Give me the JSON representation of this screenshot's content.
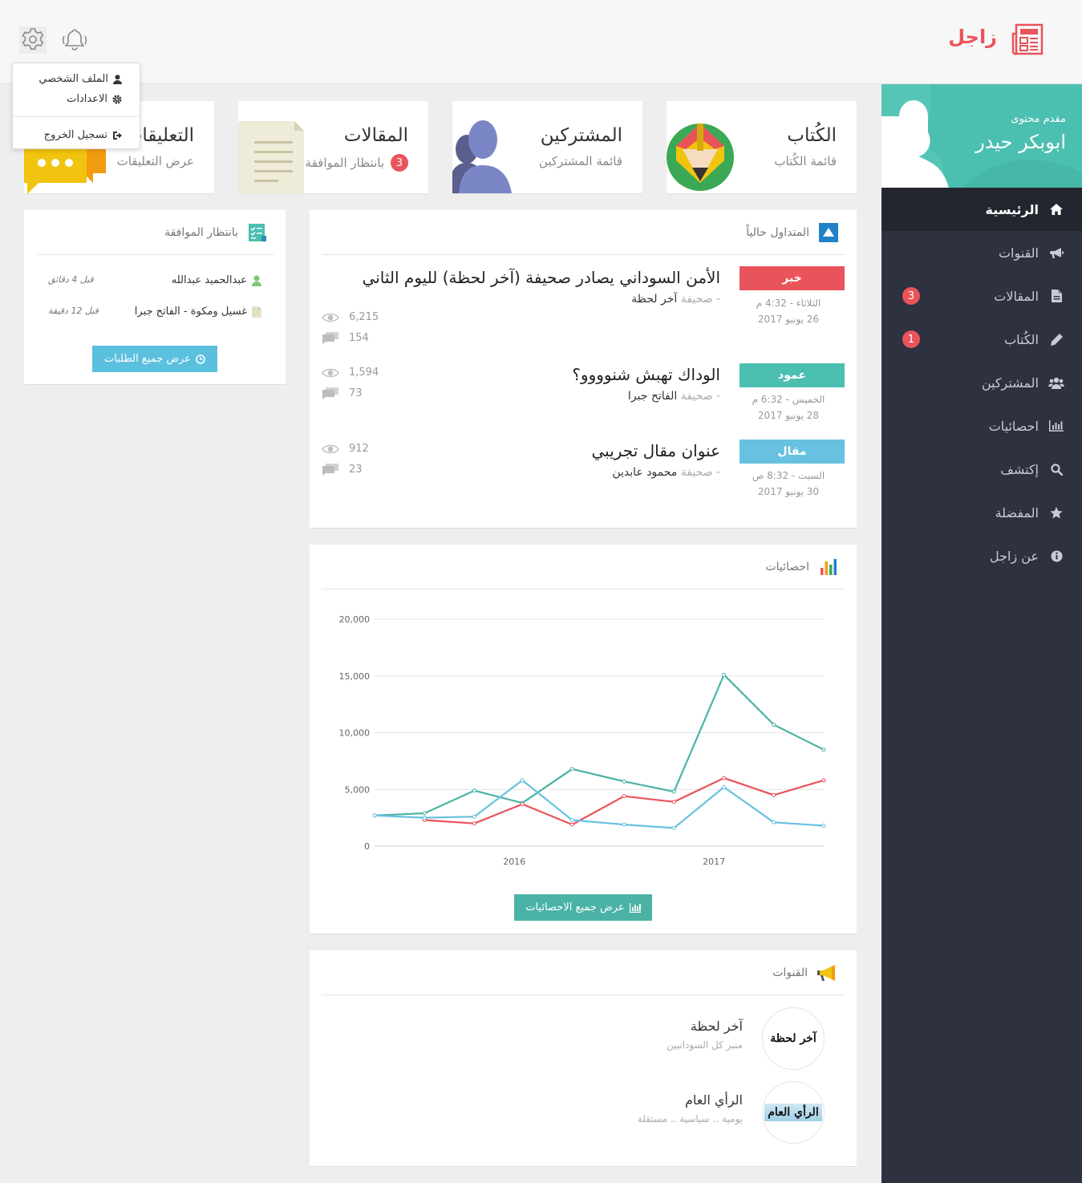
{
  "app": {
    "name": "زاجل"
  },
  "user_menu": {
    "profile": "الملف الشخصي",
    "settings": "الاعدادات",
    "logout": "تسجيل الخروج"
  },
  "profile": {
    "role": "مقدم محتوى",
    "name": "ابوبكر حيدر"
  },
  "sidebar": {
    "items": [
      {
        "label": "الرئيسية",
        "icon": "home-icon",
        "active": true
      },
      {
        "label": "القنوات",
        "icon": "megaphone-icon"
      },
      {
        "label": "المقالات",
        "icon": "file-icon",
        "badge": "3"
      },
      {
        "label": "الكُتاب",
        "icon": "pencil-icon",
        "badge": "1"
      },
      {
        "label": "المشتركين",
        "icon": "users-icon"
      },
      {
        "label": "احصائيات",
        "icon": "bar-chart-icon"
      },
      {
        "label": "إكتشف",
        "icon": "search-icon"
      },
      {
        "label": "المفضلة",
        "icon": "star-icon"
      },
      {
        "label": "عن زاجل",
        "icon": "info-icon"
      }
    ]
  },
  "stats_cards": [
    {
      "title": "الكُتاب",
      "subtitle": "قائمة الكُتاب"
    },
    {
      "title": "المشتركين",
      "subtitle": "قائمة المشتركين"
    },
    {
      "title": "المقالات",
      "subtitle": "بانتظار الموافقة",
      "badge": "3"
    },
    {
      "title": "التعليقات",
      "subtitle": "عرض التعليقات"
    }
  ],
  "trending": {
    "title": "المتداول حالياً",
    "items": [
      {
        "tag": "خبر",
        "tag_color": "#e9545a",
        "date_line1": "الثلاثاء - 4:32 م",
        "date_line2": "26 يونيو 2017",
        "title": "الأمن السوداني يصادر صحيفة (آخر لحظة) لليوم الثاني",
        "source_prefix": "- صحيفة",
        "source": "آخر لحظة",
        "views": "6,215",
        "comments": "154"
      },
      {
        "tag": "عمود",
        "tag_color": "#4bbfb0",
        "date_line1": "الخميس - 6:32 م",
        "date_line2": "28 يونيو 2017",
        "title": "الوداك تهبش شنوووو؟",
        "source_prefix": "- صحيفة",
        "source": "الفاتح جبرا",
        "views": "1,594",
        "comments": "73"
      },
      {
        "tag": "مقال",
        "tag_color": "#68c1e0",
        "date_line1": "السبت - 8:32 ص",
        "date_line2": "30 يونيو 2017",
        "title": "عنوان مقال تجريبي",
        "source_prefix": "- صحيفة",
        "source": "محمود عابدين",
        "views": "912",
        "comments": "23"
      }
    ]
  },
  "pending": {
    "title": "بانتظار الموافقة",
    "items": [
      {
        "name": "عبدالحميد عبدالله",
        "icon": "user-icon",
        "time": "قبل 4 دقائق"
      },
      {
        "name": "غسيل ومكوة - الفاتح جبرا",
        "icon": "document-icon",
        "time": "قبل 12 دقيقة"
      }
    ],
    "button": "عرض جميع الطلبات"
  },
  "stats_panel": {
    "title": "احصائيات",
    "button": "عرض جميع الاحصائيات"
  },
  "chart_data": {
    "type": "line",
    "x": [
      2015.3,
      2015.55,
      2015.8,
      2016.04,
      2016.29,
      2016.55,
      2016.8,
      2017.05,
      2017.3,
      2017.55
    ],
    "series": [
      {
        "color": "#4bb3a6",
        "values": [
          2700,
          2900,
          4900,
          3800,
          6800,
          5700,
          4800,
          15100,
          10700,
          8500
        ]
      },
      {
        "color": "#e9545a",
        "values": [
          null,
          2300,
          2000,
          3700,
          1900,
          4400,
          3900,
          6000,
          4500,
          5800
        ]
      },
      {
        "color": "#68c1e0",
        "values": [
          2700,
          2500,
          2600,
          5800,
          2300,
          1900,
          1600,
          5200,
          2100,
          1800
        ]
      }
    ],
    "x_ticks": [
      2016,
      2017
    ],
    "x_tick_labels": [
      "2016",
      "2017"
    ],
    "y_ticks": [
      0,
      5000,
      10000,
      15000,
      20000
    ],
    "y_tick_labels": [
      "0",
      "5,000",
      "10,000",
      "15,000",
      "20,000"
    ],
    "xlim": [
      2015.3,
      2017.55
    ],
    "ylim": [
      0,
      20000
    ],
    "grid": true
  },
  "channels": {
    "title": "القنوات",
    "items": [
      {
        "name": "آخر لحظة",
        "desc": "منبر كل السودانيين",
        "logo_text": "آخر لحظة"
      },
      {
        "name": "الرأي العام",
        "desc": "يومية .. سياسية .. مستقلة",
        "logo_text": "الرأي العام"
      }
    ]
  }
}
